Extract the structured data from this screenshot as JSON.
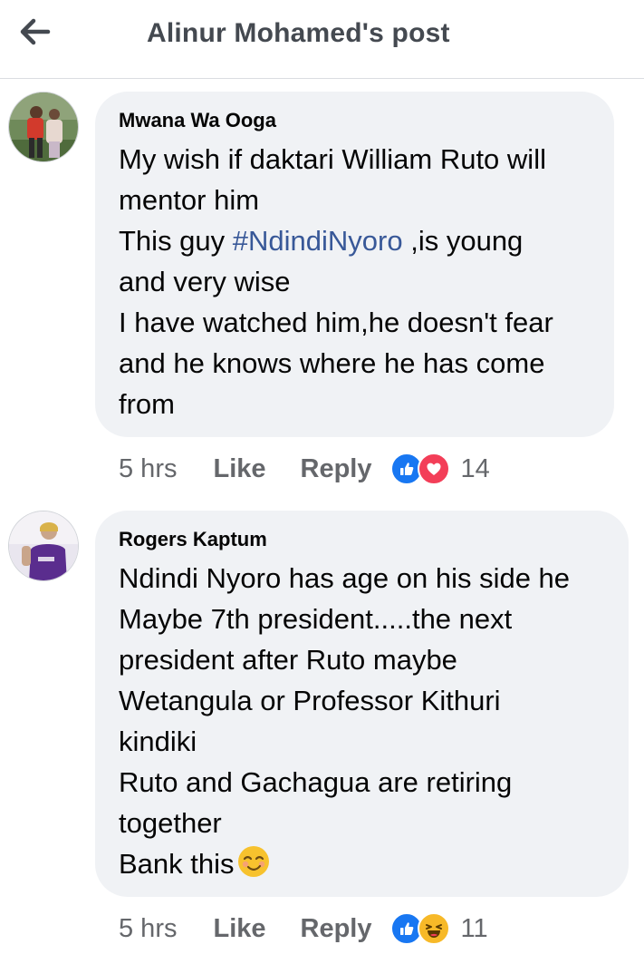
{
  "header": {
    "title": "Alinur Mohamed's post",
    "back_icon": "arrow-left-icon"
  },
  "comments": [
    {
      "author": "Mwana Wa Ooga",
      "lines": [
        "My wish if daktari William Ruto will",
        "mentor him",
        "This guy ",
        "and very wise",
        "I have watched him,he doesn't fear",
        "and he knows where he has come",
        "from"
      ],
      "hashtag": "#NdindiNyoro",
      "hashtag_suffix": " ,is young",
      "time": "5 hrs",
      "like_label": "Like",
      "reply_label": "Reply",
      "reactions": [
        "like-reaction-icon",
        "love-reaction-icon"
      ],
      "reaction_count": "14",
      "avatar_icon": "user-avatar"
    },
    {
      "author": "Rogers Kaptum",
      "lines": [
        "Ndindi Nyoro has age on his side he",
        "Maybe 7th president.....the next",
        "president after Ruto maybe",
        "Wetangula or Professor Kithuri",
        "kindiki",
        "Ruto and Gachagua are retiring",
        "together",
        "Bank this"
      ],
      "trailing_emoji": "smirk-emoji-icon",
      "time": "5 hrs",
      "like_label": "Like",
      "reply_label": "Reply",
      "reactions": [
        "like-reaction-icon",
        "haha-reaction-icon"
      ],
      "reaction_count": "11",
      "avatar_icon": "user-avatar"
    }
  ],
  "colors": {
    "bubble": "#f0f2f5",
    "hashtag": "#385898",
    "muted": "#65676b",
    "like_blue": "#1877f2",
    "love_red": "#f33e58",
    "haha_yellow": "#f7b928"
  }
}
